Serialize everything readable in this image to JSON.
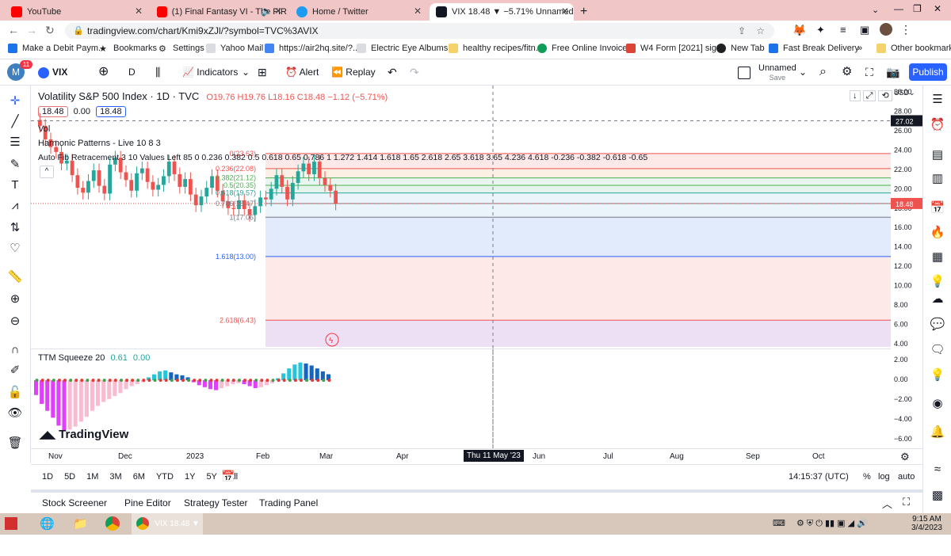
{
  "browser": {
    "tabs": [
      {
        "title": "YouTube",
        "active": false
      },
      {
        "title": "(1) Final Fantasy VI - The FIR",
        "active": false
      },
      {
        "title": "Home / Twitter",
        "active": false
      },
      {
        "title": "VIX 18.48 ▼ −5.71% Unnamed",
        "active": true
      }
    ],
    "new_tab": "+",
    "url": "tradingview.com/chart/Kmi9xZJl/?symbol=TVC%3AVIX",
    "bookmarks": [
      "Make a Debit Paym...",
      "Bookmarks",
      "Settings",
      "Yahoo Mail",
      "https://air2hq.site/?...",
      "Electric Eye Albums:...",
      "healthy recipes/fitn...",
      "Free Online Invoice...",
      "W4 Form [2021] sig...",
      "New Tab",
      "Fast Break Delivery"
    ],
    "bookmarks_overflow": "»",
    "other_bookmarks": "Other bookmarks"
  },
  "toolbar": {
    "avatar_letter": "M",
    "avatar_badge": "11",
    "symbol": "VIX",
    "interval": "D",
    "indicators": "Indicators",
    "alert": "Alert",
    "replay": "Replay",
    "layout_name": "Unnamed",
    "save": "Save",
    "publish": "Publish"
  },
  "legend": {
    "title": "Volatility S&P 500 Index · 1D · TVC",
    "open": "O19.76",
    "high": "H19.76",
    "low": "L18.16",
    "close": "C18.48",
    "change": "−1.12 (−5.71%)",
    "sell_price": "18.48",
    "spread": "0.00",
    "buy_price": "18.48",
    "vol": "Vol",
    "harmonic": "Harmonic Patterns - Live 10 8 3",
    "autofib": "Auto Fib Retracement 3 10 Values Left 85 0 0.236 0.382 0.5 0.618 0.65 0.786 1 1.272 1.414 1.618 1.65 2.618 2.65 3.618 3.65 4.236 4.618 -0.236 -0.382 -0.618 -0.65",
    "ttm": "TTM Squeeze 20",
    "ttm_v1": "0.61",
    "ttm_v2": "0.00"
  },
  "fib_labels": [
    {
      "text": "0(23.63)",
      "value": 23.63
    },
    {
      "text": "0.236(22.08)",
      "value": 22.08
    },
    {
      "text": "0.382(21.12)",
      "value": 21.12
    },
    {
      "text": "0.5(20.35)",
      "value": 20.35
    },
    {
      "text": "0.618(19.57)",
      "value": 19.57
    },
    {
      "text": "0.786(18.47)",
      "value": 18.47
    },
    {
      "text": "1(17.06)",
      "value": 17.06
    },
    {
      "text": "1.618(13.00)",
      "value": 13.0
    },
    {
      "text": "2.618(6.43)",
      "value": 6.43
    }
  ],
  "chart_data": {
    "type": "candlestick",
    "title": "Volatility S&P 500 Index · 1D · TVC",
    "price_ticks": [
      "30.00",
      "28.00",
      "26.00",
      "24.00",
      "22.00",
      "20.00",
      "18.00",
      "16.00",
      "14.00",
      "12.00",
      "10.00",
      "8.00",
      "6.00",
      "4.00"
    ],
    "ttm_ticks": [
      "2.00",
      "0.00",
      "−2.00",
      "−4.00",
      "−6.00"
    ],
    "crosshair_price": "27.02",
    "last_price": "18.48",
    "x_ticks": [
      "Nov",
      "Dec",
      "2023",
      "Feb",
      "Mar",
      "Apr",
      "Jun",
      "Jul",
      "Aug",
      "Sep",
      "Oct"
    ],
    "crosshair_date": "Thu 11 May '23",
    "close_series": [
      26.5,
      25.1,
      24.3,
      23.8,
      22.6,
      22.9,
      21.4,
      20.1,
      19.6,
      20.8,
      21.9,
      20.3,
      19.5,
      22.5,
      23.2,
      21.7,
      20.9,
      19.8,
      21.6,
      22.1,
      20.7,
      19.9,
      20.4,
      21.3,
      22.8,
      21.5,
      20.2,
      21.0,
      19.4,
      18.3,
      19.2,
      20.1,
      21.3,
      19.8,
      18.7,
      18.0,
      17.9,
      18.8,
      17.9,
      17.3,
      18.2,
      19.1,
      18.9,
      20.0,
      21.4,
      20.2,
      18.9,
      20.6,
      21.8,
      22.6,
      21.5,
      22.8,
      21.1,
      20.4,
      19.8,
      18.48
    ],
    "ttm_series": [
      -1.5,
      -2.4,
      -3.1,
      -3.8,
      -4.6,
      -5.1,
      -5.0,
      -4.7,
      -4.2,
      -3.7,
      -3.1,
      -2.6,
      -2.2,
      -1.9,
      -1.6,
      -1.3,
      -0.9,
      -0.6,
      -0.4,
      -0.2,
      0.3,
      0.6,
      0.9,
      1.0,
      0.8,
      0.6,
      0.5,
      0.3,
      -0.2,
      -0.5,
      -0.7,
      -0.9,
      -1.0,
      -0.8,
      -0.6,
      -0.4,
      -0.3,
      -0.4,
      -0.6,
      -0.8,
      -0.7,
      -0.5,
      -0.3,
      0.2,
      0.7,
      1.2,
      1.6,
      1.8,
      1.7,
      1.5,
      1.2,
      0.9,
      0.61
    ],
    "price_range": [
      3,
      31
    ],
    "ttm_range": [
      -6.5,
      2.5
    ]
  },
  "bottom": {
    "ranges": [
      "1D",
      "5D",
      "1M",
      "3M",
      "6M",
      "YTD",
      "1Y",
      "5Y",
      "All"
    ],
    "time": "14:15:37 (UTC)",
    "pct": "%",
    "log": "log",
    "auto": "auto"
  },
  "panels": [
    "Stock Screener",
    "Pine Editor",
    "Strategy Tester",
    "Trading Panel"
  ],
  "watermark": "TradingView",
  "taskbar": {
    "app_label": "VIX 18.48 ▼ ...",
    "clock_time": "9:15 AM",
    "clock_date": "3/4/2023"
  },
  "colors": {
    "accent": "#2962ff",
    "up": "#26a69a",
    "down": "#ef5350",
    "tab_strip": "#f1c6c6"
  }
}
